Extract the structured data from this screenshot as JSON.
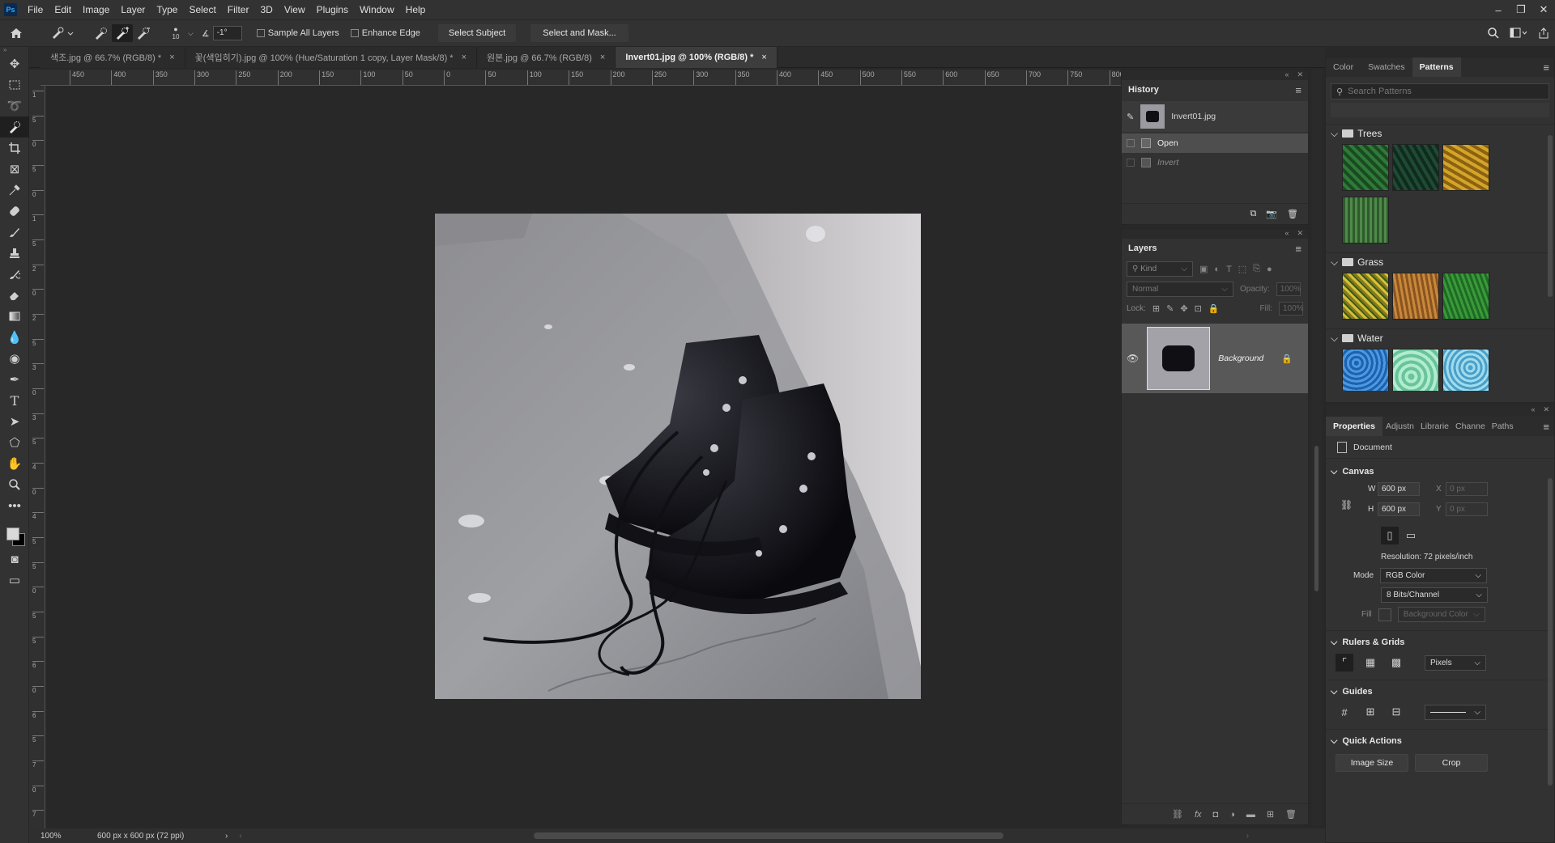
{
  "app": {
    "logo": "Ps"
  },
  "menu": [
    "File",
    "Edit",
    "Image",
    "Layer",
    "Type",
    "Select",
    "Filter",
    "3D",
    "View",
    "Plugins",
    "Window",
    "Help"
  ],
  "options": {
    "brush_size": "10",
    "angle": "-1°",
    "sample_all_layers": "Sample All Layers",
    "enhance_edge": "Enhance Edge",
    "select_subject": "Select Subject",
    "select_and_mask": "Select and Mask..."
  },
  "tabs": [
    {
      "label": "색조.jpg @ 66.7% (RGB/8) *"
    },
    {
      "label": "꽃(색입히기).jpg @ 100% (Hue/Saturation 1 copy, Layer Mask/8) *"
    },
    {
      "label": "원본.jpg @ 66.7% (RGB/8)"
    },
    {
      "label": "Invert01.jpg @ 100% (RGB/8) *"
    }
  ],
  "ruler_h": [
    "450",
    "400",
    "350",
    "300",
    "250",
    "200",
    "150",
    "100",
    "50",
    "0",
    "50",
    "100",
    "150",
    "200",
    "250",
    "300",
    "350",
    "400",
    "450",
    "500",
    "550",
    "600",
    "650",
    "700",
    "750",
    "800"
  ],
  "ruler_v": [
    "1",
    "5",
    "0",
    "5",
    "0",
    "1",
    "5",
    "2",
    "0",
    "2",
    "5",
    "3",
    "0",
    "3",
    "5",
    "4",
    "0",
    "4",
    "5",
    "5",
    "0",
    "5",
    "5",
    "6",
    "0",
    "6",
    "5",
    "7",
    "0",
    "7"
  ],
  "status": {
    "zoom": "100%",
    "doc_info": "600 px x 600 px (72 ppi)"
  },
  "history": {
    "title": "History",
    "snapshot": "Invert01.jpg",
    "items": [
      {
        "label": "Open"
      },
      {
        "label": "Invert"
      }
    ]
  },
  "layers": {
    "title": "Layers",
    "kind": "Kind",
    "blend": "Normal",
    "opacity_label": "Opacity:",
    "opacity": "100%",
    "lock_label": "Lock:",
    "fill_label": "Fill:",
    "fill": "100%",
    "items": [
      {
        "name": "Background"
      }
    ]
  },
  "patterns_panel": {
    "tabs": [
      "Color",
      "Swatches",
      "Patterns"
    ],
    "search_placeholder": "Search Patterns",
    "groups": [
      {
        "name": "Trees",
        "swatches": [
          "#1f5a2a",
          "#163a28",
          "#b8891c",
          "#3d6b3a"
        ]
      },
      {
        "name": "Grass",
        "swatches": [
          "#b59a2a",
          "#a86e2e",
          "#2a7a2e"
        ]
      },
      {
        "name": "Water",
        "swatches": [
          "#2f7dcc",
          "#86d4b0",
          "#6bb8d8"
        ]
      }
    ]
  },
  "properties": {
    "tabs": [
      "Properties",
      "Adjustn",
      "Librarie",
      "Channe",
      "Paths"
    ],
    "doc_label": "Document",
    "canvas_title": "Canvas",
    "w_label": "W",
    "w": "600 px",
    "h_label": "H",
    "h": "600 px",
    "x_label": "X",
    "x": "0 px",
    "y_label": "Y",
    "y": "0 px",
    "resolution": "Resolution: 72 pixels/inch",
    "mode_label": "Mode",
    "mode": "RGB Color",
    "bits": "8 Bits/Channel",
    "fill_label": "Fill",
    "fill": "Background Color",
    "rulers_title": "Rulers & Grids",
    "units": "Pixels",
    "guides_title": "Guides",
    "quick_title": "Quick Actions",
    "image_size": "Image Size",
    "crop": "Crop"
  }
}
